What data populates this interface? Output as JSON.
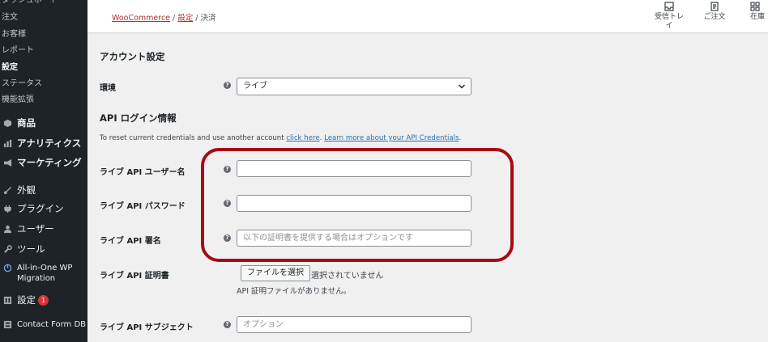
{
  "sidebar": {
    "submenu": [
      "ダッシュボード",
      "注文",
      "お客様",
      "レポート",
      "設定",
      "ステータス",
      "機能拡張"
    ],
    "items": [
      {
        "label": "商品",
        "icon": "cube-icon"
      },
      {
        "label": "アナリティクス",
        "icon": "bar-chart-icon"
      },
      {
        "label": "マーケティング",
        "icon": "megaphone-icon"
      },
      {
        "label": "外観",
        "icon": "paintbrush-icon"
      },
      {
        "label": "プラグイン",
        "icon": "plug-icon"
      },
      {
        "label": "ユーザー",
        "icon": "user-icon"
      },
      {
        "label": "ツール",
        "icon": "wrench-icon"
      },
      {
        "label": "All-in-One WP Migration",
        "icon": "migration-icon"
      },
      {
        "label": "設定",
        "icon": "settings-icon",
        "badge": "1"
      },
      {
        "label": "Contact Form DB",
        "icon": "database-icon"
      }
    ]
  },
  "topbar": {
    "breadcrumb": {
      "woocommerce": "WooCommerce",
      "settings": "設定",
      "current": "決済",
      "sep": "/"
    },
    "buttons": {
      "inbox": "受信トレイ",
      "orders": "ご注文",
      "stock": "在庫"
    }
  },
  "main": {
    "account_heading": "アカウント設定",
    "environment": {
      "label": "環境",
      "value": "ライブ"
    },
    "api_heading": "API ログイン情報",
    "credentials_text": "To reset current credentials and use another account ",
    "click_here": "click here",
    "learn_more": "Learn more about your API Credentials",
    "username": {
      "label": "ライブ API ユーザー名",
      "value": ""
    },
    "password": {
      "label": "ライブ API パスワード",
      "value": ""
    },
    "signature": {
      "label": "ライブ API 署名",
      "placeholder": "以下の証明書を提供する場合はオプションです"
    },
    "certificate": {
      "label": "ライブ API 証明書",
      "button": "ファイルを選択",
      "status": "選択されていません",
      "note": "API 証明ファイルがありません。"
    },
    "subject": {
      "label": "ライブ API サブジェクト",
      "placeholder": "オプション"
    }
  },
  "help_glyph": "?",
  "colors": {
    "sidebar_bg": "#1d2327",
    "highlight": "#a80a12",
    "link": "#2271b1",
    "breadcrumb_link": "#b32d2e",
    "badge": "#d63638"
  }
}
